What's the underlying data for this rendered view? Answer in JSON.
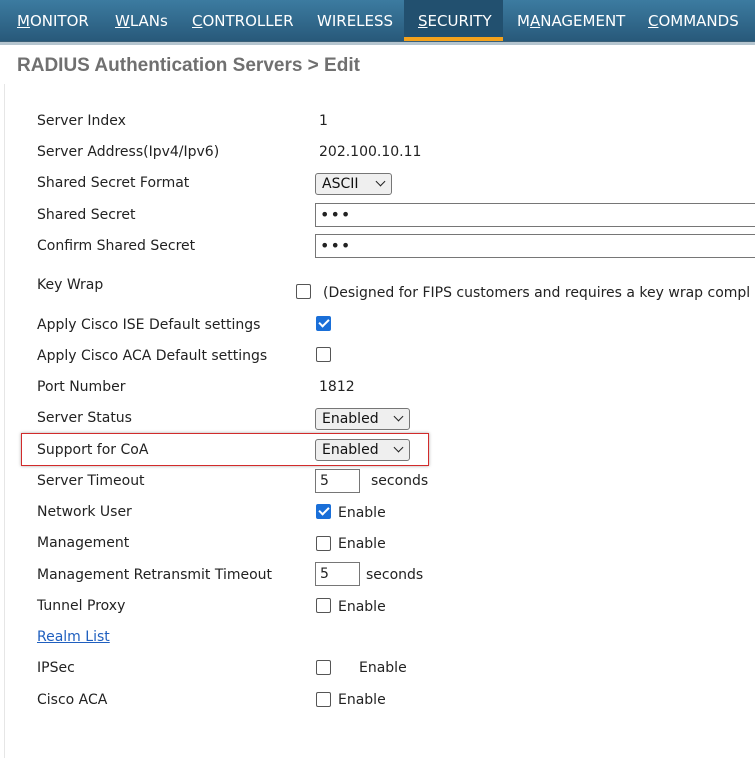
{
  "nav": {
    "items": [
      {
        "label_u": "M",
        "label_rest": "ONITOR"
      },
      {
        "label_u": "W",
        "label_rest": "LANs"
      },
      {
        "label_u": "C",
        "label_rest": "ONTROLLER"
      },
      {
        "label_u": "W",
        "label_rest": "IRELESS",
        "plain_first": true
      },
      {
        "label_u": "S",
        "label_rest": "ECURITY",
        "active": true
      },
      {
        "label_pre": "M",
        "label_u": "A",
        "label_rest": "NAGEMENT"
      },
      {
        "label_u": "C",
        "label_rest": "OMMANDS"
      }
    ]
  },
  "page_title": "RADIUS Authentication Servers > Edit",
  "form": {
    "server_index": {
      "label": "Server Index",
      "value": "1"
    },
    "server_address": {
      "label": "Server Address(Ipv4/Ipv6)",
      "value": "202.100.10.11"
    },
    "shared_secret_format": {
      "label": "Shared Secret Format",
      "value": "ASCII"
    },
    "shared_secret": {
      "label": "Shared Secret",
      "value": "•••"
    },
    "confirm_shared_secret": {
      "label": "Confirm Shared Secret",
      "value": "•••"
    },
    "key_wrap": {
      "label": "Key Wrap",
      "checked": false,
      "note": "(Designed for FIPS customers and requires a key wrap compl"
    },
    "apply_ise": {
      "label": "Apply Cisco ISE Default settings",
      "checked": true
    },
    "apply_aca": {
      "label": "Apply Cisco ACA Default settings",
      "checked": false
    },
    "port_number": {
      "label": "Port Number",
      "value": "1812"
    },
    "server_status": {
      "label": "Server Status",
      "value": "Enabled"
    },
    "support_coa": {
      "label": "Support for CoA",
      "value": "Enabled"
    },
    "server_timeout": {
      "label": "Server Timeout",
      "value": "5",
      "unit": "seconds"
    },
    "network_user": {
      "label": "Network User",
      "checked": true,
      "text": "Enable"
    },
    "management": {
      "label": "Management",
      "checked": false,
      "text": "Enable"
    },
    "mgmt_retransmit": {
      "label": "Management Retransmit Timeout",
      "value": "5",
      "unit": "seconds"
    },
    "tunnel_proxy": {
      "label": "Tunnel Proxy",
      "checked": false,
      "text": "Enable"
    },
    "realm_list": {
      "label": "Realm List"
    },
    "ipsec": {
      "label": "IPSec",
      "checked": false,
      "text": "Enable"
    },
    "cisco_aca": {
      "label": "Cisco ACA",
      "checked": false,
      "text": "Enable"
    }
  },
  "colors": {
    "nav_bg": "#2f6a8f",
    "active_tab_underline": "#f4a21c",
    "checkbox_checked": "#1a6fd8",
    "highlight_border": "#d22b2b",
    "link": "#1f5fbf"
  }
}
